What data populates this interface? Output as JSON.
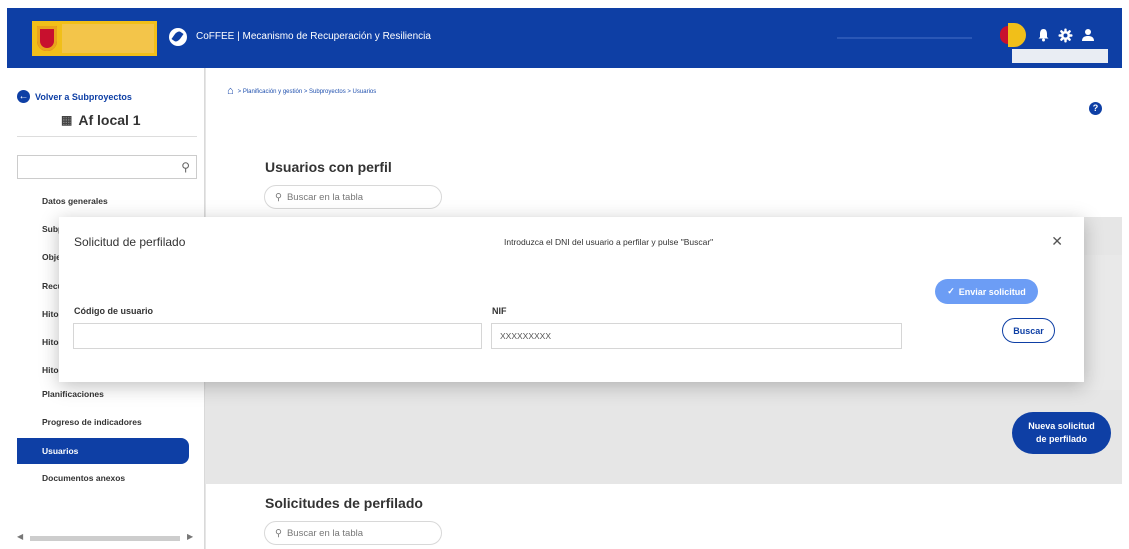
{
  "header": {
    "app_title": "CoFFEE  |  Mecanismo de Recuperación y Resiliencia",
    "icons": [
      "prtr-logo-icon",
      "bell-icon",
      "gear-icon",
      "user-icon"
    ]
  },
  "sidebar": {
    "back_label": "Volver a Subproyectos",
    "project_title": "Af local 1",
    "items": [
      {
        "label": "Datos generales"
      },
      {
        "label": "Subproyectos"
      },
      {
        "label": "Objetivos"
      },
      {
        "label": "Recursos"
      },
      {
        "label": "Hitos"
      },
      {
        "label": "Hitos"
      },
      {
        "label": "Hitos"
      },
      {
        "label": "Planificaciones"
      },
      {
        "label": "Progreso de indicadores"
      },
      {
        "label": "Usuarios",
        "active": true
      },
      {
        "label": "Documentos anexos"
      }
    ]
  },
  "breadcrumb": {
    "text": "> Planificación y gestión > Subproyectos > Usuarios"
  },
  "main": {
    "section1_title": "Usuarios con perfil",
    "section2_title": "Solicitudes de perfilado",
    "table_search_placeholder": "Buscar en la tabla",
    "new_request_line1": "Nueva solicitud",
    "new_request_line2": "de perfilado"
  },
  "modal": {
    "title": "Solicitud de perfilado",
    "instructions": "Introduzca el DNI del usuario a perfilar y pulse \"Buscar\"",
    "send_label": "Enviar solicitud",
    "user_code_label": "Código de usuario",
    "user_code_value": "",
    "nif_label": "NIF",
    "nif_value": "XXXXXXXXX",
    "search_label": "Buscar"
  },
  "colors": {
    "primary": "#0e3fa5",
    "send_button": "#6c9df5",
    "gov_yellow": "#f1bf19",
    "gov_red": "#c8102e"
  }
}
